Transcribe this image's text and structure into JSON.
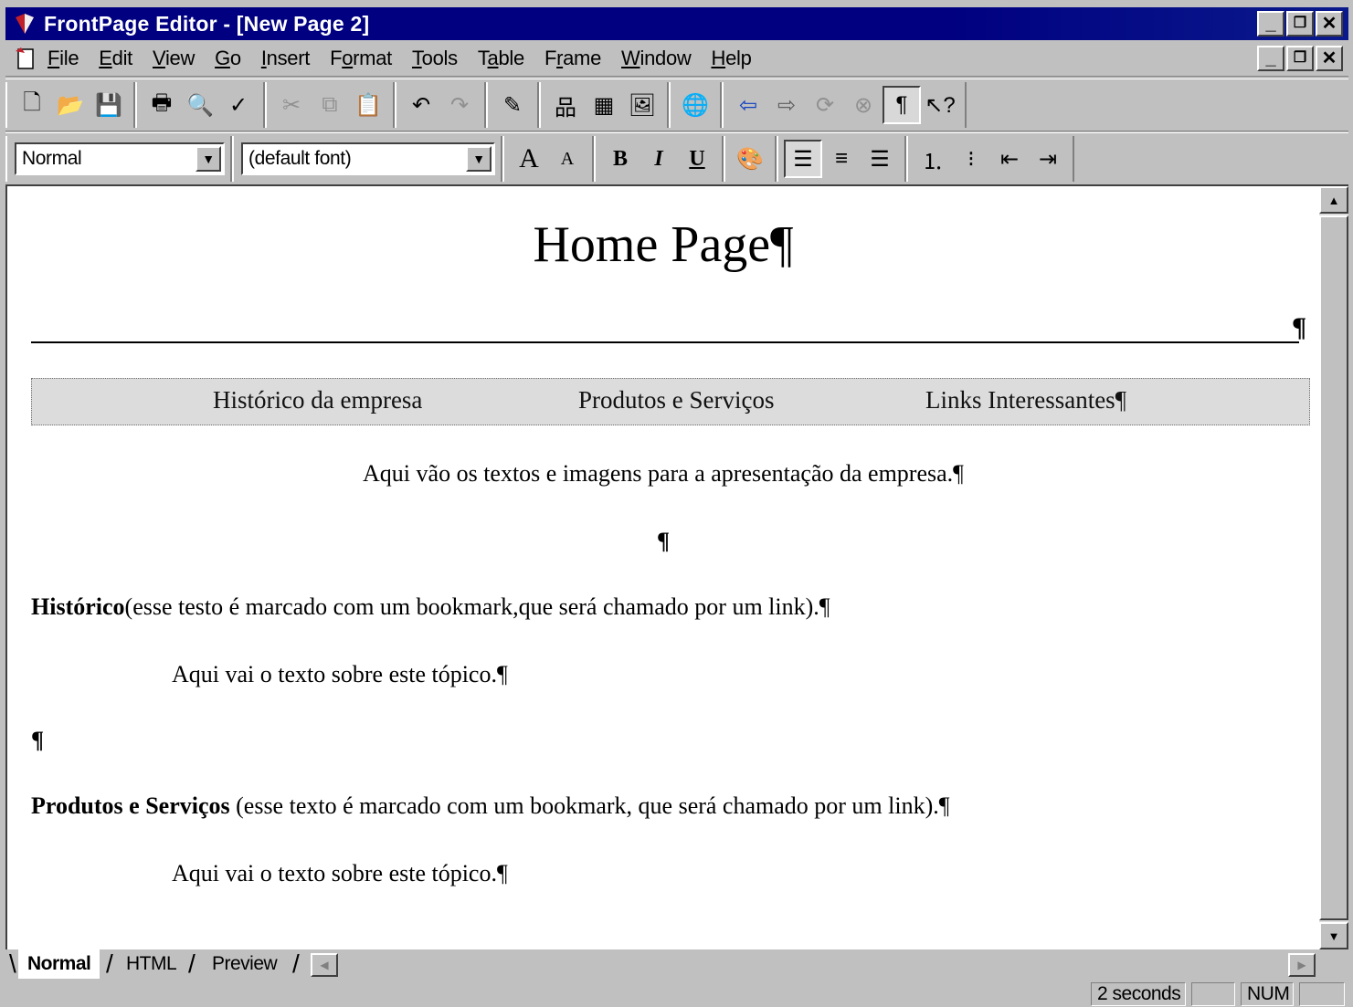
{
  "window": {
    "title": "FrontPage Editor - [New Page 2]",
    "min_glyph": "_",
    "max_glyph": "🗗",
    "close_glyph": "✕"
  },
  "menu": [
    {
      "pre": "",
      "u": "F",
      "post": "ile"
    },
    {
      "pre": "",
      "u": "E",
      "post": "dit"
    },
    {
      "pre": "",
      "u": "V",
      "post": "iew"
    },
    {
      "pre": "",
      "u": "G",
      "post": "o"
    },
    {
      "pre": "",
      "u": "I",
      "post": "nsert"
    },
    {
      "pre": "F",
      "u": "o",
      "post": "rmat"
    },
    {
      "pre": "",
      "u": "T",
      "post": "ools"
    },
    {
      "pre": "T",
      "u": "a",
      "post": "ble"
    },
    {
      "pre": "F",
      "u": "r",
      "post": "ame"
    },
    {
      "pre": "",
      "u": "W",
      "post": "indow"
    },
    {
      "pre": "",
      "u": "H",
      "post": "elp"
    }
  ],
  "format_toolbar": {
    "style_value": "Normal",
    "font_value": "(default font)",
    "bold_glyph": "B",
    "italic_glyph": "I",
    "underline_glyph": "U"
  },
  "document": {
    "heading": "Home Page¶",
    "hr_pilcrow": "¶",
    "nav": {
      "link1": "Histórico da empresa",
      "link2": "Produtos e Serviços",
      "link3": "Links Interessantes¶"
    },
    "intro": "Aqui vão os textos e imagens para a apresentação da empresa.¶",
    "empty_centered": "¶",
    "section1": {
      "title": "Histórico",
      "note": "(esse testo é marcado com um bookmark,que será chamado por um link).¶",
      "body": "Aqui vai o texto sobre este tópico.¶"
    },
    "empty_left": "¶",
    "section2": {
      "title": "Produtos e Serviços",
      "note": " (esse texto é marcado com um bookmark, que será chamado por um link).¶",
      "body": "Aqui vai o texto sobre este tópico.¶"
    }
  },
  "tabs": {
    "normal": "Normal",
    "html": "HTML",
    "preview": "Preview"
  },
  "status": {
    "time": "2 seconds",
    "num": "NUM"
  }
}
